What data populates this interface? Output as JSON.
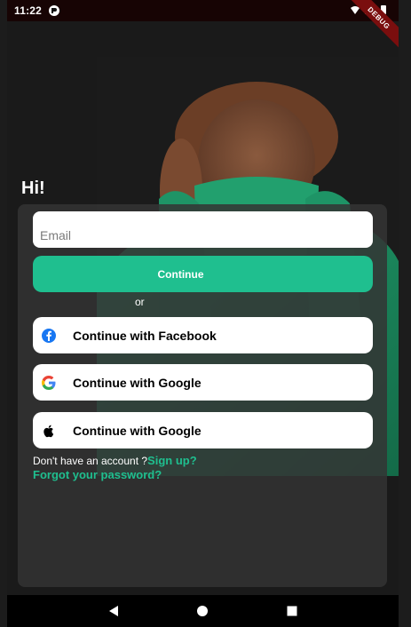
{
  "status_bar": {
    "time": "11:22",
    "debug_banner": "DEBUG"
  },
  "greeting": "Hi!",
  "email": {
    "placeholder": "Email",
    "value": ""
  },
  "continue_label": "Continue",
  "or_label": "or",
  "social": [
    {
      "label": "Continue with Facebook",
      "icon": "facebook-icon"
    },
    {
      "label": "Continue with Google",
      "icon": "google-icon"
    },
    {
      "label": "Continue with Google",
      "icon": "apple-icon"
    }
  ],
  "signup": {
    "prompt": "Don't have an account ?",
    "link": "Sign up?"
  },
  "forgot_label": "Forgot your password?",
  "colors": {
    "accent": "#1fbf8f",
    "card": "#343434",
    "background": "#1a1a1a",
    "sweater": "#1f9a6a"
  },
  "nav": {
    "back_icon": "back-triangle-icon",
    "home_icon": "home-circle-icon",
    "recents_icon": "recents-square-icon"
  }
}
